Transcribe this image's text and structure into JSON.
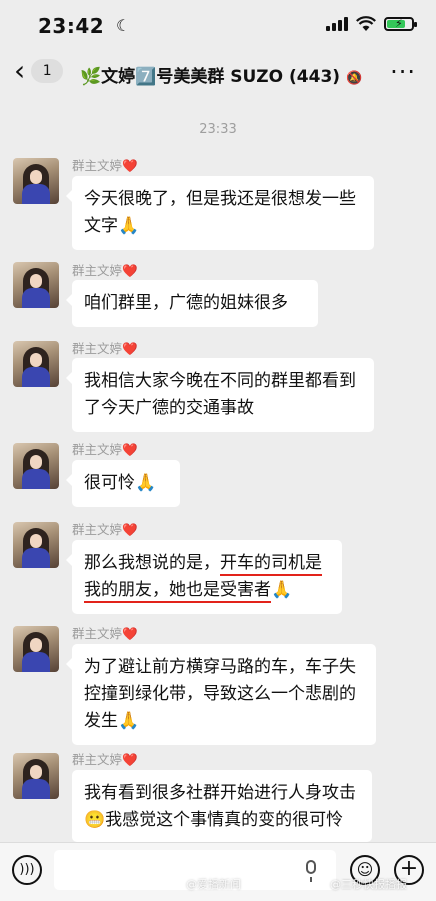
{
  "status_bar": {
    "time": "23:42",
    "moon_icon": "☾",
    "battery_icon": "battery-charging-icon"
  },
  "nav": {
    "back_chevron": "‹",
    "unread_count": "1",
    "leaf": "🌿",
    "title": "文婷",
    "title_badge": "7️⃣",
    "title_rest": "号美美群 SUZO",
    "member_count": "(443)",
    "mute": "🔕",
    "more": "···"
  },
  "chat": {
    "timestamp": "23:33",
    "messages": [
      {
        "sender": "群主文婷",
        "heart": "❤️",
        "text": "今天很晚了，但是我还是很想发一些文字🙏"
      },
      {
        "sender": "群主文婷",
        "heart": "❤️",
        "text": "咱们群里，广德的姐妹很多"
      },
      {
        "sender": "群主文婷",
        "heart": "❤️",
        "text": "我相信大家今晚在不同的群里都看到了今天广德的交通事故"
      },
      {
        "sender": "群主文婷",
        "heart": "❤️",
        "text": "很可怜🙏"
      },
      {
        "sender": "群主文婷",
        "heart": "❤️",
        "text_part1": "那么我想说的是，",
        "text_part2": "开车的司机是",
        "text_part3": "我的朋友，她也是受害者",
        "text_part4": "🙏"
      },
      {
        "sender": "群主文婷",
        "heart": "❤️",
        "text": "为了避让前方横穿马路的车，车子失控撞到绿化带，导致这么一个悲剧的发生🙏"
      },
      {
        "sender": "群主文婷",
        "heart": "❤️",
        "text": "我有看到很多社群开始进行人身攻击😬我感觉这个事情真的变的很可怜"
      }
    ]
  },
  "input": {
    "voice_icon": "🔊",
    "emoji_icon": "☺",
    "plus_icon": "+",
    "value": ""
  },
  "watermark": {
    "left": "@爱播新闻",
    "right": "@三秒快报播报"
  },
  "colors": {
    "background": "#ededed",
    "bubble": "#ffffff",
    "underline": "#e2231a",
    "heart": "#e02020"
  }
}
